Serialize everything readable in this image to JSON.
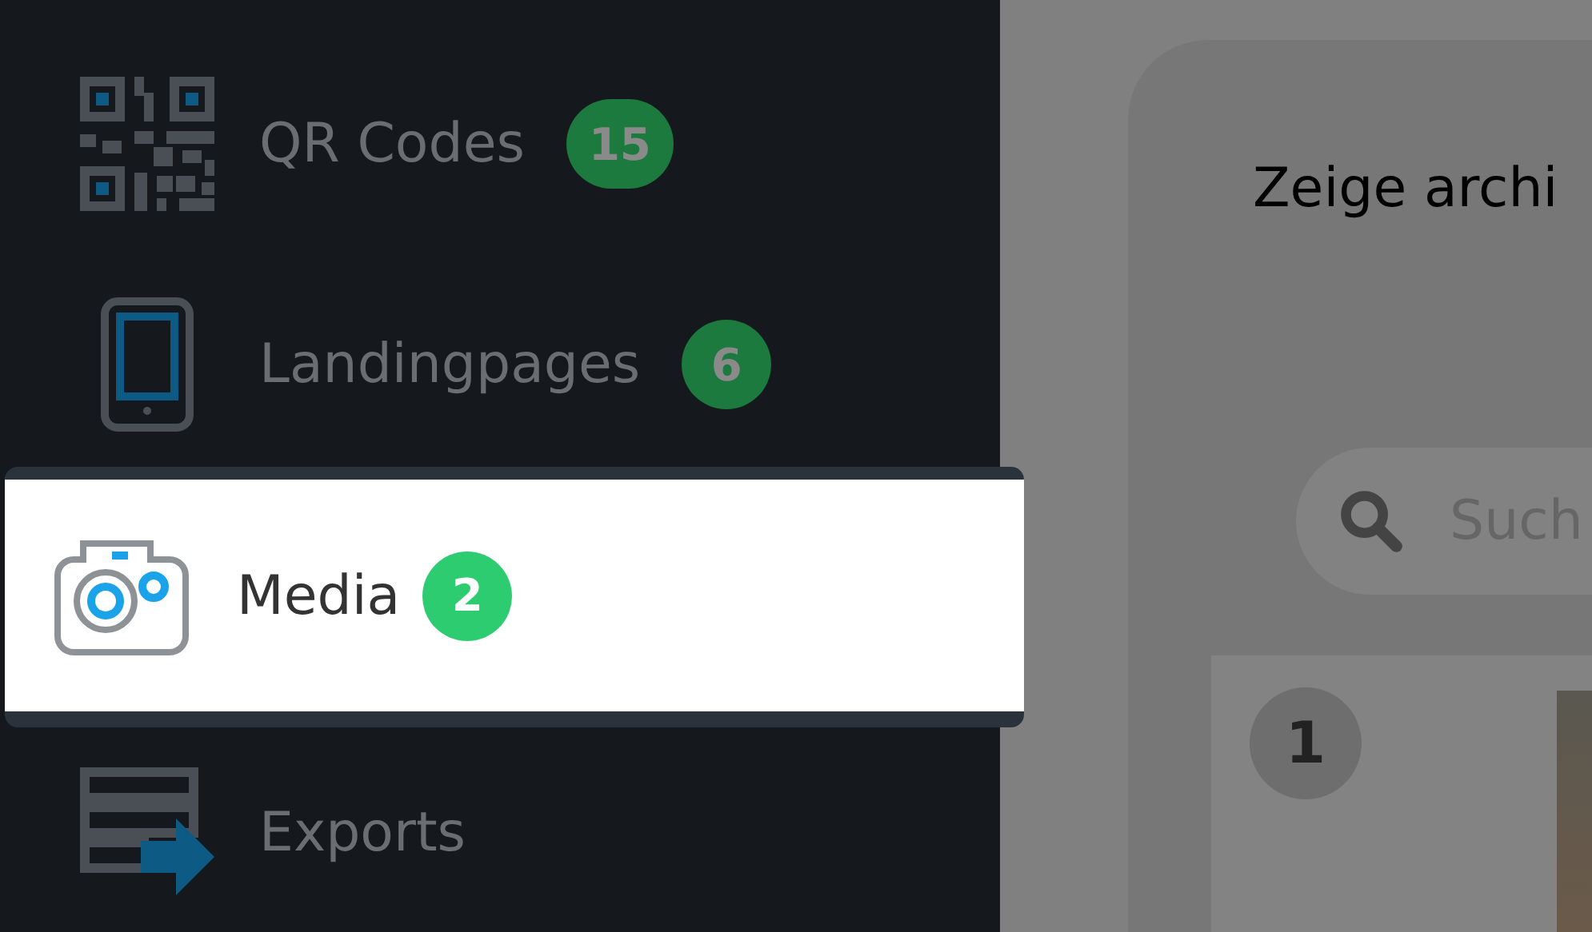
{
  "sidebar": {
    "items": [
      {
        "kind": "qr",
        "label": "QR Codes",
        "badge": "15",
        "selected": false
      },
      {
        "kind": "phone",
        "label": "Landingpages",
        "badge": "6",
        "selected": false
      },
      {
        "kind": "camera",
        "label": "Media",
        "badge": "2",
        "selected": true
      },
      {
        "kind": "export",
        "label": "Exports",
        "selected": false
      }
    ]
  },
  "main": {
    "title": "Zeige archi",
    "search": {
      "placeholder": "Such"
    },
    "rows": [
      {
        "number": "1"
      }
    ]
  }
}
